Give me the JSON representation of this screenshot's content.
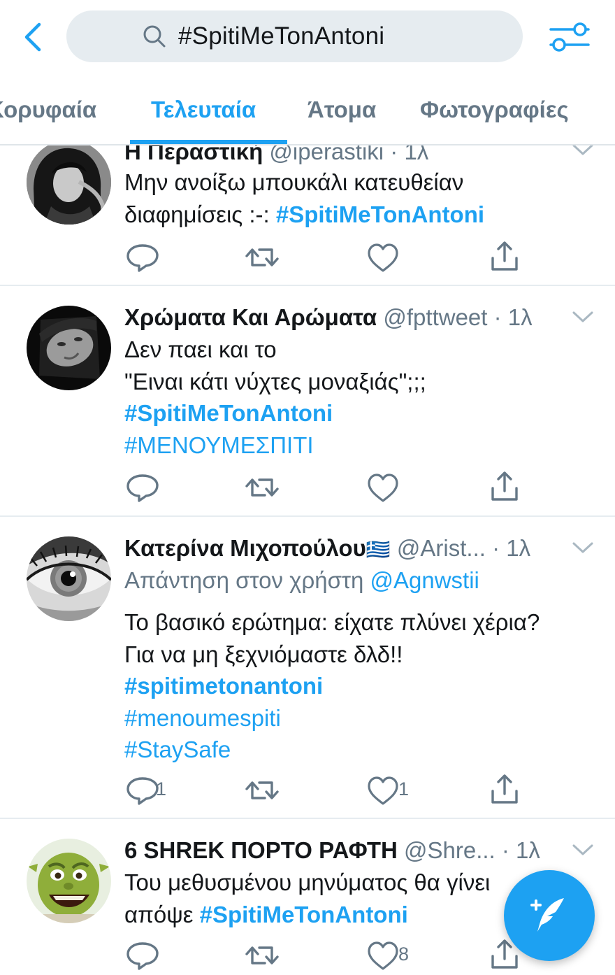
{
  "search": {
    "query": "#SpitiMeTonAntoni"
  },
  "tabs": [
    {
      "label": "Κορυφαία"
    },
    {
      "label": "Τελευταία"
    },
    {
      "label": "Άτομα"
    },
    {
      "label": "Φωτογραφίες"
    }
  ],
  "active_tab": "Τελευταία",
  "tweets": [
    {
      "name": "Η Περαστική",
      "handle": "@iperastiki",
      "time": "· 1λ",
      "lines": [
        "Μην ανοίξω μπουκάλι κατευθείαν",
        "διαφημίσεις :-:"
      ],
      "hashtag_inline": "#SpitiMeTonAntoni",
      "reply_count": "",
      "like_count": ""
    },
    {
      "name": "Χρώματα Και Αρώματα",
      "handle": "@fpttweet",
      "time": "· 1λ",
      "lines": [
        "Δεν παει και το",
        "\"Ειναι κάτι νύχτες μοναξιάς\";;;"
      ],
      "hashtags": [
        "#SpitiMeTonAntoni",
        "#ΜΕΝΟΥΜΕΣΠΙΤΙ"
      ],
      "reply_count": "",
      "like_count": ""
    },
    {
      "name": "Κατερίνα Μιχοπούλου",
      "flag": "🇬🇷",
      "handle": "@Arist...",
      "time": "· 1λ",
      "reply_prefix": "Απάντηση στον χρήστη",
      "reply_mention": "@Agnwstii",
      "lines": [
        "Το βασικό ερώτημα: είχατε πλύνει χέρια?",
        "Για να μη ξεχνιόμαστε δλδ!!"
      ],
      "hashtags": [
        "#spitimetonantoni",
        "#menoumespiti",
        "#StaySafe"
      ],
      "reply_count": "1",
      "like_count": "1"
    },
    {
      "name": "6 SHREK ΠΟΡΤΟ ΡΑΦΤΗ",
      "handle": "@Shre...",
      "time": "· 1λ",
      "lines": [
        "Του μεθυσμένου μηνύματος θα γίνει",
        "απόψε"
      ],
      "hashtag_inline": "#SpitiMeTonAntoni",
      "reply_count": "",
      "like_count": "8"
    }
  ],
  "colors": {
    "accent": "#1da1f2",
    "muted": "#657786",
    "text": "#14171a",
    "search_bg": "#e6ecf0"
  },
  "icons": [
    "back-arrow-icon",
    "search-icon",
    "filter-icon",
    "reply-icon",
    "retweet-icon",
    "like-icon",
    "share-icon",
    "chevron-down-icon",
    "compose-icon"
  ]
}
